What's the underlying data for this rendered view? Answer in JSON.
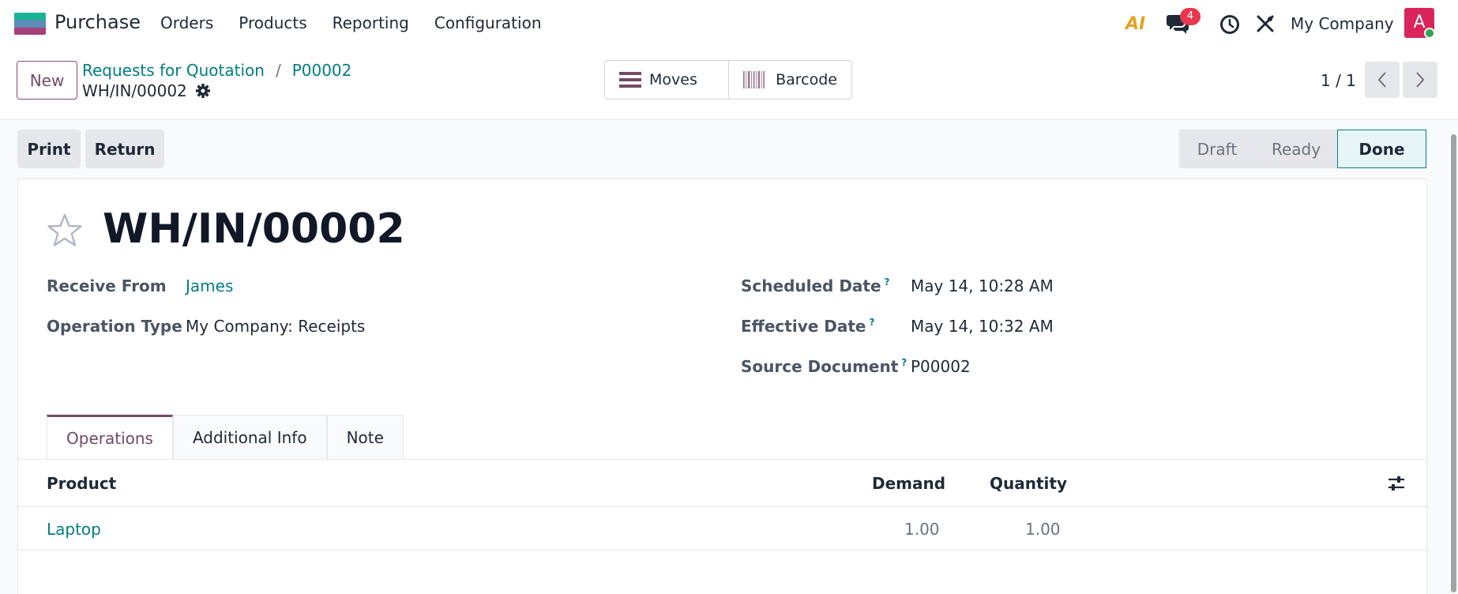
{
  "app": {
    "name": "Purchase",
    "menu": [
      "Orders",
      "Products",
      "Reporting",
      "Configuration"
    ],
    "notification_count": "4",
    "company": "My Company",
    "avatar_letter": "A",
    "ai_label": "AI"
  },
  "control": {
    "new_label": "New",
    "breadcrumb": [
      "Requests for Quotation",
      "P00002"
    ],
    "breadcrumb_sep": "/",
    "record": "WH/IN/00002",
    "smart_buttons": [
      {
        "label": "Moves",
        "icon": "list-icon"
      },
      {
        "label": "Barcode",
        "icon": "barcode-icon"
      }
    ],
    "pager": "1 / 1"
  },
  "actions": {
    "print": "Print",
    "return": "Return"
  },
  "status": {
    "stages": [
      "Draft",
      "Ready",
      "Done"
    ],
    "current": "Done"
  },
  "form": {
    "title": "WH/IN/00002",
    "left_fields": [
      {
        "label": "Receive From",
        "value": "James"
      },
      {
        "label": "Operation Type",
        "value": "My Company: Receipts"
      }
    ],
    "right_fields": [
      {
        "label": "Scheduled Date",
        "help": "?",
        "value": "May 14, 10:28 AM"
      },
      {
        "label": "Effective Date",
        "help": "?",
        "value": "May 14, 10:32 AM"
      },
      {
        "label": "Source Document",
        "help": "?",
        "value": "P00002"
      }
    ],
    "tabs": [
      "Operations",
      "Additional Info",
      "Note"
    ],
    "active_tab": "Operations"
  },
  "table": {
    "headers": {
      "product": "Product",
      "demand": "Demand",
      "quantity": "Quantity"
    },
    "rows": [
      {
        "product": "Laptop",
        "demand": "1.00",
        "quantity": "1.00"
      }
    ]
  },
  "colors": {
    "brand": "#714b67",
    "link": "#017e84",
    "badge": "#e8384f",
    "avatar": "#d9245c"
  }
}
